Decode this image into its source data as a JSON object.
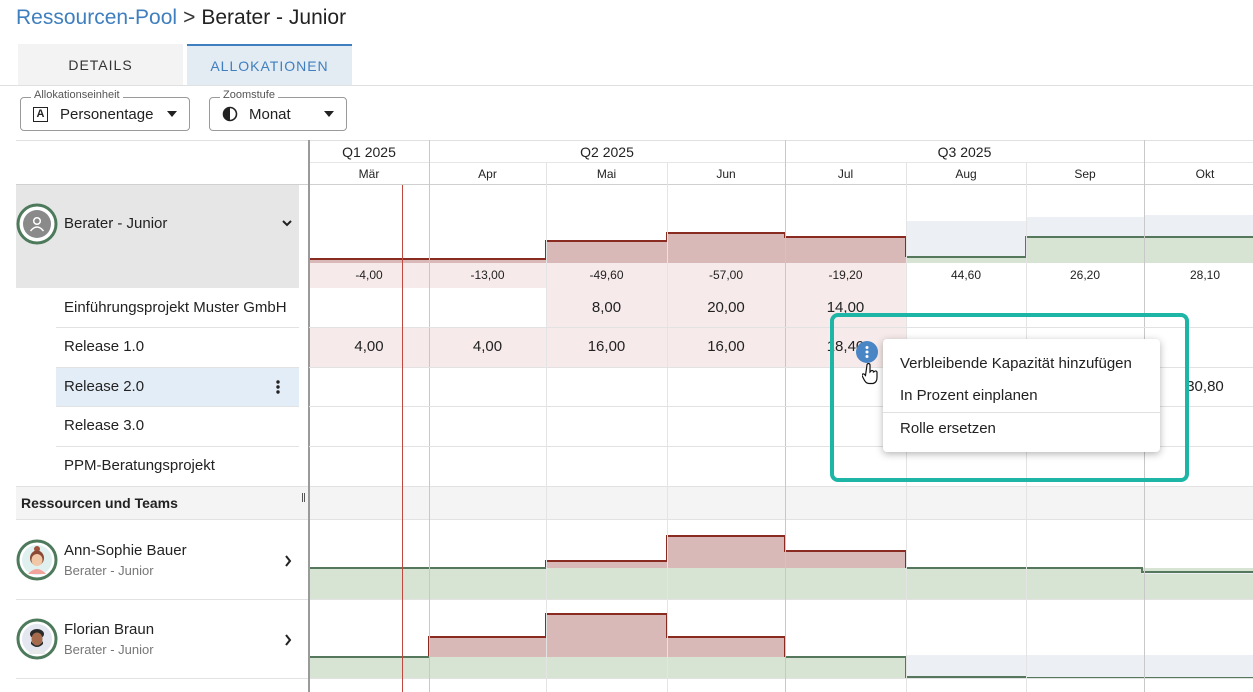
{
  "breadcrumb": {
    "parent": "Ressourcen-Pool",
    "separator": ">",
    "current": "Berater - Junior"
  },
  "tabs": [
    {
      "label": "DETAILS"
    },
    {
      "label": "ALLOKATIONEN"
    }
  ],
  "filters": {
    "unit": {
      "label": "Allokationseinheit",
      "value": "Personentage"
    },
    "zoom": {
      "label": "Zoomstufe",
      "value": "Monat"
    }
  },
  "timeline": {
    "quarters": [
      "Q1 2025",
      "Q2 2025",
      "Q3 2025"
    ],
    "months": [
      "Mär",
      "Apr",
      "Mai",
      "Jun",
      "Jul",
      "Aug",
      "Sep",
      "Okt"
    ]
  },
  "role": {
    "name": "Berater - Junior"
  },
  "role_balance": [
    "-4,00",
    "-13,00",
    "-49,60",
    "-57,00",
    "-19,20",
    "44,60",
    "26,20",
    "28,10"
  ],
  "projects": [
    {
      "name": "Einführungsprojekt Muster GmbH",
      "values": [
        "",
        "",
        "8,00",
        "20,00",
        "14,00",
        "",
        "",
        ""
      ]
    },
    {
      "name": "Release 1.0",
      "values": [
        "4,00",
        "4,00",
        "16,00",
        "16,00",
        "18,40",
        "",
        "",
        ""
      ]
    },
    {
      "name": "Release 2.0",
      "values": [
        "",
        "",
        "",
        "",
        "",
        "",
        "",
        "30,80"
      ]
    },
    {
      "name": "Release 3.0",
      "values": [
        "",
        "",
        "",
        "",
        "",
        "",
        "",
        ""
      ]
    },
    {
      "name": "PPM-Beratungsprojekt",
      "values": [
        "",
        "",
        "",
        "",
        "",
        "",
        "",
        ""
      ]
    }
  ],
  "section": {
    "title": "Ressourcen und Teams"
  },
  "resources": [
    {
      "name": "Ann-Sophie Bauer",
      "role": "Berater - Junior"
    },
    {
      "name": "Florian Braun",
      "role": "Berater - Junior"
    }
  ],
  "context_menu": {
    "items": [
      "Verbleibende Kapazität hinzufügen",
      "In Prozent einplanen",
      "Rolle ersetzen"
    ]
  },
  "colors": {
    "accent": "#3f7fbf",
    "highlight": "#1db5a5",
    "over": "#d9b8b8",
    "under": "#d8e4d3"
  }
}
